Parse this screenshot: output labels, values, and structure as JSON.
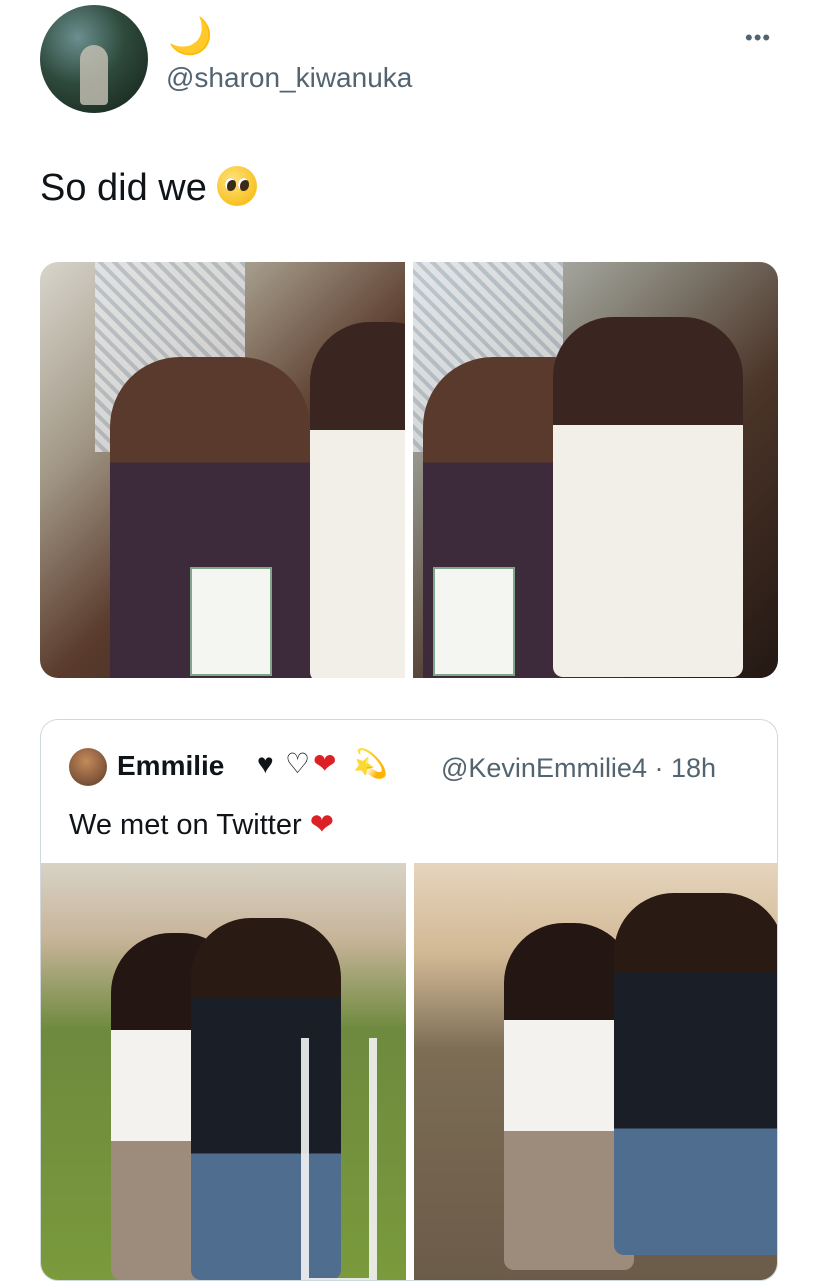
{
  "tweet": {
    "moon_emoji": "🌙",
    "handle": "@sharon_kiwanuka",
    "more_label": "•••",
    "text": "So did we"
  },
  "photos": [
    {
      "alt": "couple photo 1"
    },
    {
      "alt": "couple photo 2"
    }
  ],
  "quoted_tweet": {
    "name": "Emmilie",
    "emojis": [
      "♥",
      "♡",
      "❤",
      "💫"
    ],
    "handle_time": "@KevinEmmilie4 · 18h",
    "text": "We met on Twitter",
    "text_emoji": "❤"
  },
  "icons": {
    "more": "more-options-icon",
    "pleading": "pleading-face-icon"
  }
}
